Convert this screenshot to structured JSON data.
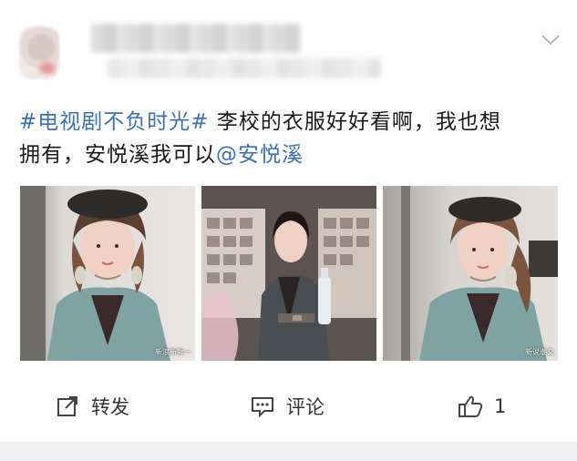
{
  "post": {
    "hashtag": "#电视剧不负时光#",
    "body_line1": " 李校的衣服好好看啊，我也想",
    "body_line2": "拥有，安悦溪我可以",
    "mention": "@安悦溪"
  },
  "images": [
    {
      "watermark": "新浪新鲜一"
    },
    {
      "watermark": ""
    },
    {
      "watermark": "新说潮文"
    }
  ],
  "actions": {
    "repost_label": "转发",
    "comment_label": "评论",
    "like_count": "1"
  },
  "icons": {
    "menu": "chevron-down-icon",
    "repost": "share-icon",
    "comment": "comment-icon",
    "like": "thumbs-up-icon"
  },
  "colors": {
    "link": "#3b6fb3",
    "text": "#1a1a1a",
    "background": "#efeff1"
  }
}
